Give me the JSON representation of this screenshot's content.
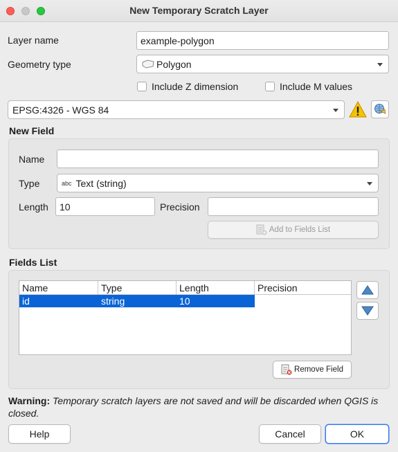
{
  "window": {
    "title": "New Temporary Scratch Layer"
  },
  "form": {
    "layer_name_label": "Layer name",
    "layer_name_value": "example-polygon",
    "geometry_type_label": "Geometry type",
    "geometry_type_value": "Polygon",
    "include_z_label": "Include Z dimension",
    "include_m_label": "Include M values",
    "crs_value": "EPSG:4326 - WGS 84"
  },
  "new_field": {
    "section_title": "New Field",
    "name_label": "Name",
    "name_value": "",
    "type_label": "Type",
    "type_prefix": "abc",
    "type_value": "Text (string)",
    "length_label": "Length",
    "length_value": "10",
    "precision_label": "Precision",
    "precision_value": "",
    "add_button_label": "Add to Fields List"
  },
  "fields_list": {
    "section_title": "Fields List",
    "columns": [
      "Name",
      "Type",
      "Length",
      "Precision"
    ],
    "rows": [
      {
        "name": "id",
        "type": "string",
        "length": "10",
        "precision": ""
      }
    ],
    "remove_button_label": "Remove Field"
  },
  "warning": {
    "bold": "Warning:",
    "text": " Temporary scratch layers are not saved and will be discarded when QGIS is closed."
  },
  "buttons": {
    "help": "Help",
    "cancel": "Cancel",
    "ok": "OK"
  },
  "icons": {
    "warning": "warning-triangle-icon",
    "crs_select": "globe-crs-icon",
    "polygon": "polygon-icon",
    "move_up": "arrow-up-icon",
    "move_down": "arrow-down-icon",
    "add_field": "add-field-icon",
    "remove_field": "remove-field-icon"
  },
  "colors": {
    "selection": "#0a64d6",
    "default_button": "#3478f6",
    "warning": "#f5c400"
  }
}
